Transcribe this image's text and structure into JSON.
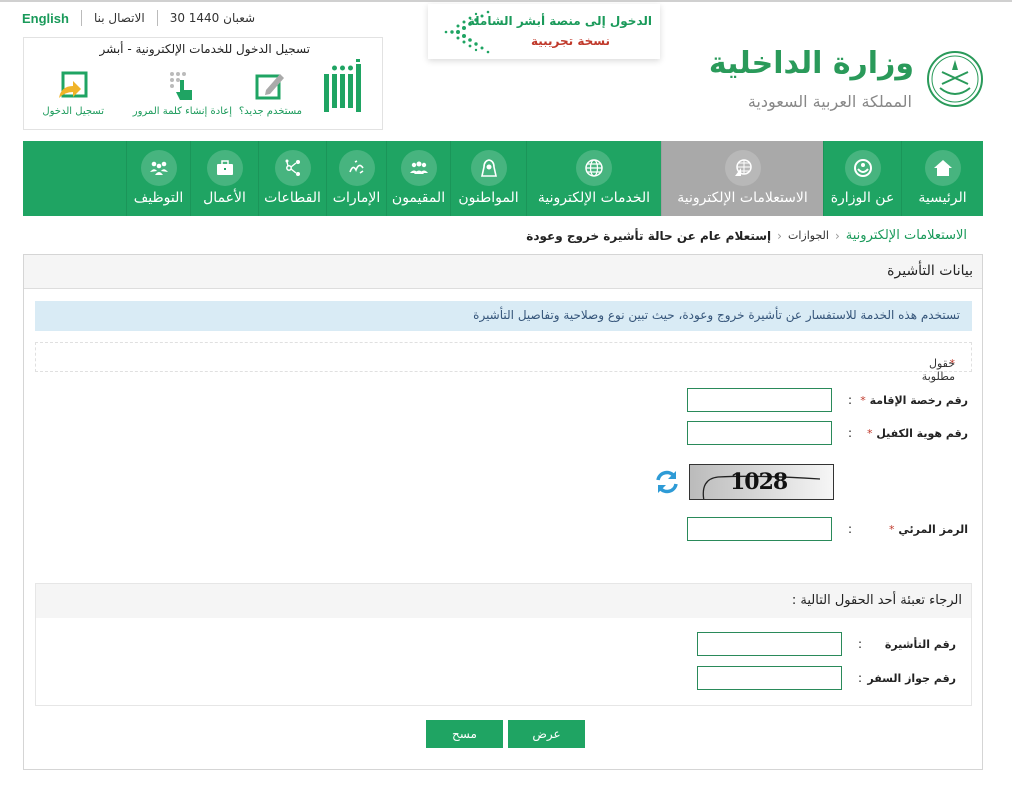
{
  "top_links": {
    "english": "English",
    "contact": "الاتصال بنا",
    "date": "30 شعبان 1440"
  },
  "absher_box": {
    "title": "تسجيل الدخول للخدمات الإلكترونية - أبشر",
    "actions": [
      {
        "label": "مستخدم جديد؟",
        "icon": "edit-icon"
      },
      {
        "label": "إعادة إنشاء كلمة المرور",
        "icon": "keypad-hand-icon"
      },
      {
        "label": "تسجيل الدخول",
        "icon": "login-icon"
      }
    ]
  },
  "promo": {
    "line1": "الدخول إلى منصة أبشر الشاملة",
    "line2": "نسخة تجريبية"
  },
  "ministry": {
    "name": "وزارة الداخلية",
    "country": "المملكة العربية السعودية"
  },
  "nav": {
    "items": [
      {
        "label": "الرئيسية",
        "icon": "home-icon",
        "active": false
      },
      {
        "label": "عن الوزارة",
        "icon": "ministry-emblem-icon",
        "active": false
      },
      {
        "label": "الاستعلامات الإلكترونية",
        "icon": "inquiry-globe-icon",
        "active": true
      },
      {
        "label": "الخدمات الإلكترونية",
        "icon": "globe-icon",
        "active": false
      },
      {
        "label": "المواطنون",
        "icon": "citizen-icon",
        "active": false
      },
      {
        "label": "المقيمون",
        "icon": "residents-icon",
        "active": false
      },
      {
        "label": "الإمارات",
        "icon": "emirates-icon",
        "active": false
      },
      {
        "label": "القطاعات",
        "icon": "sectors-share-icon",
        "active": false
      },
      {
        "label": "الأعمال",
        "icon": "briefcase-icon",
        "active": false
      },
      {
        "label": "التوظيف",
        "icon": "employment-icon",
        "active": false
      }
    ]
  },
  "breadcrumb": {
    "items": [
      "الاستعلامات الإلكترونية",
      "الجوازات",
      "إستعلام عام عن حالة تأشيرة خروج وعودة"
    ]
  },
  "panel": {
    "title": "بيانات التأشيرة",
    "info": "تستخدم هذه الخدمة للاستفسار عن تأشيرة خروج وعودة، حيث تبين نوع وصلاحية وتفاصيل التأشيرة",
    "required_note": "حقول مطلوبة",
    "required_star": "*",
    "fields": {
      "iqama": {
        "label": "رقم رخصة الإقامة",
        "value": ""
      },
      "sponsor": {
        "label": "رقم هوية الكفيل",
        "value": ""
      },
      "captcha_code": {
        "label": "الرمز المرئي",
        "value": ""
      }
    },
    "captcha_text": "1028",
    "colon": ":",
    "section2": {
      "title": "الرجاء تعبئة أحد الحقول التالية :",
      "fields": {
        "visa_number": {
          "label": "رقم التأشيرة",
          "value": ""
        },
        "passport_number": {
          "label": "رقم جواز السفر",
          "value": ""
        }
      }
    },
    "buttons": {
      "view": "عرض",
      "clear": "مسح"
    }
  },
  "colors": {
    "brand_green": "#1fa463",
    "active_nav": "#a9a9a9",
    "info_bg": "#d9ebf5",
    "required_red": "#c0392b"
  }
}
